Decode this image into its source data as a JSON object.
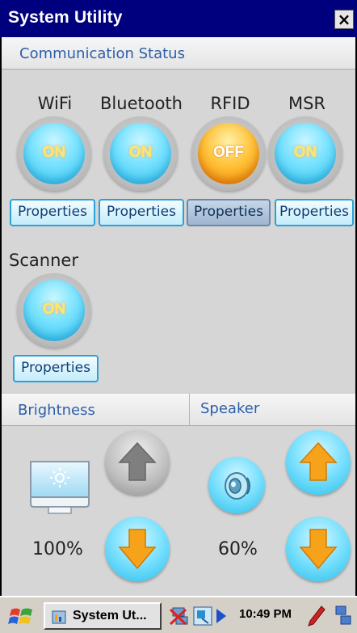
{
  "window": {
    "title": "System Utility",
    "close_label": "×"
  },
  "communication": {
    "header": "Communication Status",
    "devices": [
      {
        "label": "WiFi",
        "state": "ON",
        "properties_label": "Properties"
      },
      {
        "label": "Bluetooth",
        "state": "ON",
        "properties_label": "Properties"
      },
      {
        "label": "RFID",
        "state": "OFF",
        "properties_label": "Properties"
      },
      {
        "label": "MSR",
        "state": "ON",
        "properties_label": "Properties"
      },
      {
        "label": "Scanner",
        "state": "ON",
        "properties_label": "Properties"
      }
    ]
  },
  "brightness": {
    "header": "Brightness",
    "value_label": "100%",
    "level": 100
  },
  "speaker": {
    "header": "Speaker",
    "value_label": "60%",
    "level": 60
  },
  "taskbar": {
    "app_label": "System Ut...",
    "time": "10:49 PM"
  },
  "colors": {
    "title_bar": "#00007f",
    "on_toggle": "#2bc3ef",
    "off_toggle": "#f58a00",
    "header_text": "#2d5fa8"
  }
}
